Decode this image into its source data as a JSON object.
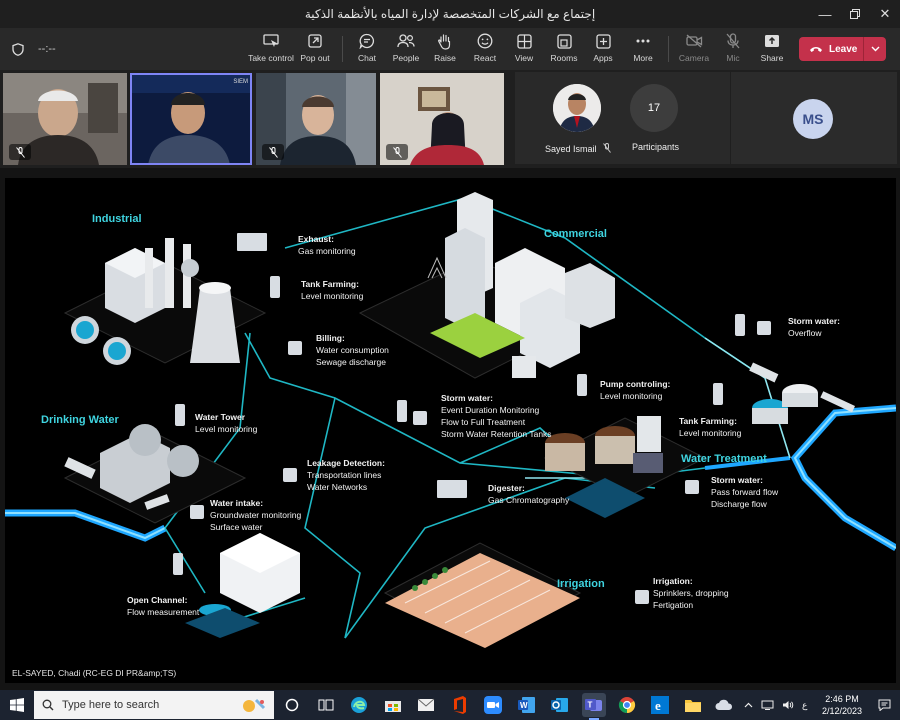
{
  "window": {
    "title": "إجتماع مع الشركات المتخصصة لإدارة المياه بالأنظمة الذكية"
  },
  "toolbar": {
    "timer": "--:--",
    "items": [
      {
        "label": "Take control",
        "icon": "take-control-icon"
      },
      {
        "label": "Pop out",
        "icon": "pop-out-icon"
      },
      {
        "label": "Chat",
        "icon": "chat-icon"
      },
      {
        "label": "People",
        "icon": "people-icon"
      },
      {
        "label": "Raise",
        "icon": "raise-hand-icon"
      },
      {
        "label": "React",
        "icon": "react-icon"
      },
      {
        "label": "View",
        "icon": "view-icon"
      },
      {
        "label": "Rooms",
        "icon": "rooms-icon"
      },
      {
        "label": "Apps",
        "icon": "apps-icon"
      },
      {
        "label": "More",
        "icon": "more-icon"
      },
      {
        "label": "Camera",
        "icon": "camera-off-icon"
      },
      {
        "label": "Mic",
        "icon": "mic-off-icon"
      },
      {
        "label": "Share",
        "icon": "share-icon"
      }
    ],
    "leave_label": "Leave",
    "leave_color": "#c4314b"
  },
  "participants": {
    "tiles": [
      {
        "tile_label": "SIEM"
      }
    ],
    "pinned_name": "Sayed Ismail",
    "count": "17",
    "count_label": "Participants",
    "initials": "MS"
  },
  "slide": {
    "areas": {
      "industrial": "Industrial",
      "commercial": "Commercial",
      "drinking_water": "Drinking Water",
      "water_treatment": "Water Treatment",
      "irrigation": "Irrigation"
    },
    "callouts": [
      {
        "heading": "Exhaust:",
        "lines": [
          "Gas monitoring"
        ]
      },
      {
        "heading": "Tank Farming:",
        "lines": [
          "Level monitoring"
        ]
      },
      {
        "heading": "Billing:",
        "lines": [
          "Water consumption",
          "Sewage discharge"
        ]
      },
      {
        "heading": "Storm water:",
        "lines": [
          "Overflow"
        ]
      },
      {
        "heading": "Pump controling:",
        "lines": [
          "Level monitoring"
        ]
      },
      {
        "heading": "Storm water:",
        "lines": [
          "Event Duration Monitoring",
          "Flow to Full Treatment",
          "Storm Water Retention Tanks"
        ]
      },
      {
        "heading": "Water Tower",
        "lines": [
          "Level monitoring"
        ]
      },
      {
        "heading": "Tank Farming:",
        "lines": [
          "Level monitoring"
        ]
      },
      {
        "heading": "Leakage Detection:",
        "lines": [
          "Transportation lines",
          "Water Networks"
        ]
      },
      {
        "heading": "Storm water:",
        "lines": [
          "Pass forward flow",
          "Discharge flow"
        ]
      },
      {
        "heading": "Digester:",
        "lines": [
          "Gas Chromatography"
        ]
      },
      {
        "heading": "Water intake:",
        "lines": [
          "Groundwater monitoring",
          "Surface water"
        ]
      },
      {
        "heading": "Open Channel:",
        "lines": [
          "Flow measurement"
        ]
      },
      {
        "heading": "Irrigation:",
        "lines": [
          "Sprinklers, dropping",
          "Fertigation"
        ]
      }
    ],
    "presenter": "EL-SAYED, Chadi (RC-EG DI PR&amp;TS)",
    "accent_color": "#3fd4e0"
  },
  "taskbar": {
    "search_placeholder": "Type here to search",
    "apps": [
      "task-view-icon",
      "edge-icon",
      "store-icon",
      "mail-icon",
      "office-icon",
      "zoom-icon",
      "word-icon",
      "outlook-icon",
      "teams-icon",
      "chrome-icon",
      "edge-alt-icon",
      "file-explorer-icon"
    ],
    "language": "ع",
    "time": "2:46 PM",
    "date": "2/12/2023"
  }
}
